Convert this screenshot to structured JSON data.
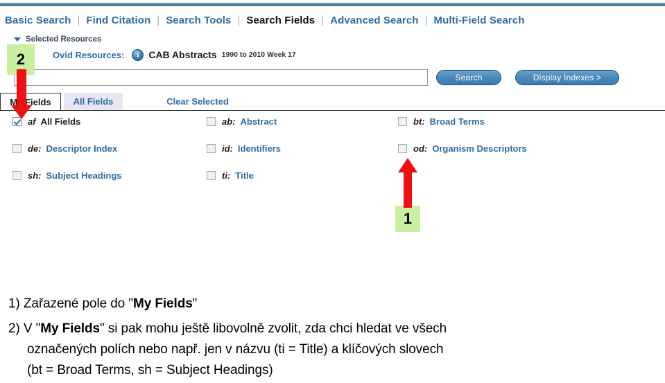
{
  "nav": {
    "separator": "|",
    "items": [
      {
        "label": "Basic Search",
        "active": false
      },
      {
        "label": "Find Citation",
        "active": false
      },
      {
        "label": "Search Tools",
        "active": false
      },
      {
        "label": "Search Fields",
        "active": true
      },
      {
        "label": "Advanced Search",
        "active": false
      },
      {
        "label": "Multi-Field Search",
        "active": false
      }
    ]
  },
  "selected_resources": {
    "heading": "Selected Resources",
    "caret_icon": "triangle-down-icon",
    "ovid_label": "Ovid Resources:",
    "info_icon": "info-icon",
    "info_glyph": "i",
    "database": "CAB Abstracts",
    "coverage": "1990 to 2010 Week 17"
  },
  "search": {
    "value": "",
    "placeholder": "",
    "search_button": "Search",
    "display_indexes_button": "Display Indexes >"
  },
  "tabs": [
    {
      "label": "My Fields",
      "active": true
    },
    {
      "label": "All Fields",
      "active": false
    },
    {
      "label": "Clear Selected",
      "active": false
    }
  ],
  "fields": [
    [
      {
        "code": "af",
        "name": "All Fields",
        "checked": true,
        "dark": true
      },
      {
        "code": "ab:",
        "name": "Abstract",
        "checked": false,
        "dark": false
      },
      {
        "code": "bt:",
        "name": "Broad Terms",
        "checked": false,
        "dark": false
      }
    ],
    [
      {
        "code": "de:",
        "name": "Descriptor Index",
        "checked": false,
        "dark": false
      },
      {
        "code": "id:",
        "name": "Identifiers",
        "checked": false,
        "dark": false
      },
      {
        "code": "od:",
        "name": "Organism Descriptors",
        "checked": false,
        "dark": false
      }
    ],
    [
      {
        "code": "sh:",
        "name": "Subject Headings",
        "checked": false,
        "dark": false
      },
      {
        "code": "ti:",
        "name": "Title",
        "checked": false,
        "dark": false
      },
      {
        "code": "",
        "name": "",
        "checked": false,
        "dark": false
      }
    ]
  ],
  "annotations": {
    "badge_one": "1",
    "badge_two": "2",
    "arrow_up_icon": "arrow-up-icon",
    "arrow_down_icon": "arrow-down-icon",
    "badge_color": "#c9f0a0",
    "arrow_color": "#ee1111"
  },
  "caption": {
    "line1_prefix": "1) Zařazené pole do \"",
    "line1_bold": "My Fields",
    "line1_suffix": "\"",
    "line2_prefix": "2) V \"",
    "line2_bold": "My Fields",
    "line2_suffix": "\" si pak mohu ještě libovolně zvolit, zda chci hledat ve všech",
    "line3": "označených polích nebo např. jen v názvu (ti = Title) a klíčových slovech",
    "line4": "(bt = Broad Terms, sh = Subject Headings)"
  }
}
